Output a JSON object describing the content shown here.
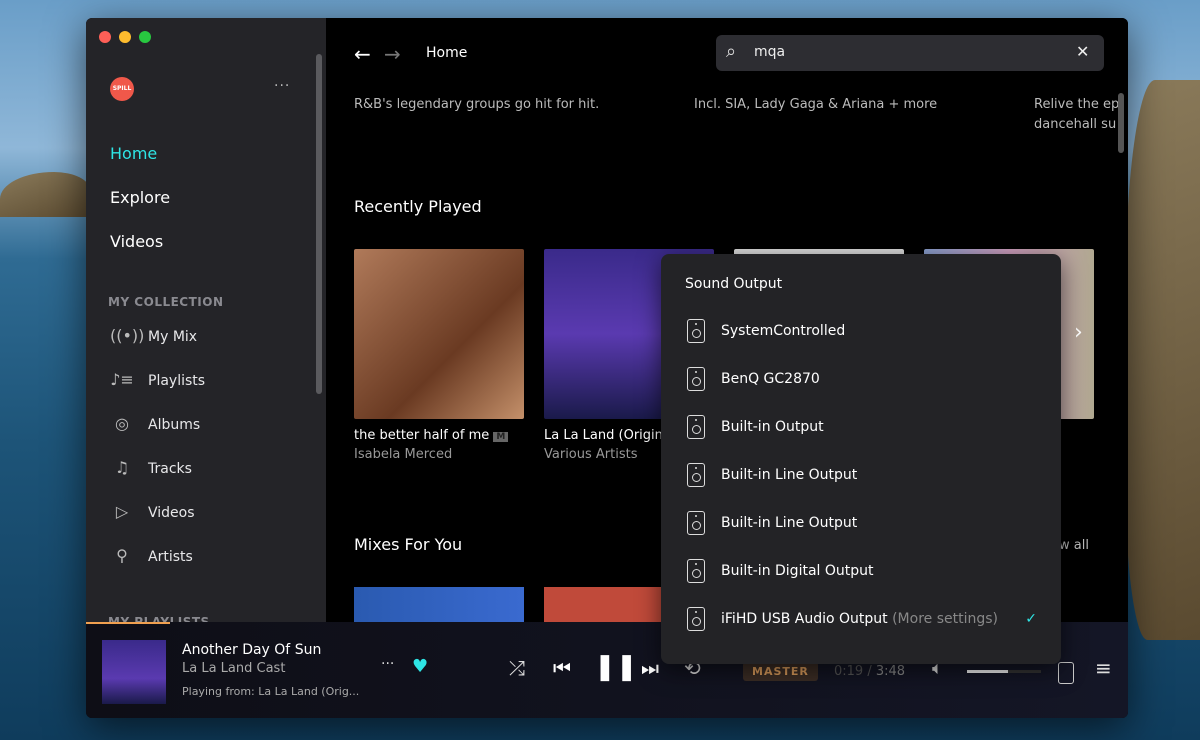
{
  "window": {
    "controls": [
      "close",
      "minimize",
      "maximize"
    ]
  },
  "sidebar": {
    "logo": "SPILL",
    "more": "···",
    "nav": [
      {
        "label": "Home",
        "active": true
      },
      {
        "label": "Explore"
      },
      {
        "label": "Videos"
      }
    ],
    "collection_header": "MY COLLECTION",
    "collection": [
      {
        "label": "My Mix",
        "icon": "radio-icon"
      },
      {
        "label": "Playlists",
        "icon": "playlist-icon"
      },
      {
        "label": "Albums",
        "icon": "album-icon"
      },
      {
        "label": "Tracks",
        "icon": "note-icon"
      },
      {
        "label": "Videos",
        "icon": "video-icon"
      },
      {
        "label": "Artists",
        "icon": "microphone-icon"
      }
    ],
    "playlists_header": "MY PLAYLISTS"
  },
  "header": {
    "breadcrumb": "Home",
    "search_value": "mqa"
  },
  "main": {
    "descriptions": [
      "R&B's legendary groups go hit for hit.",
      "Incl. SIA, Lady Gaga & Ariana + more",
      "Relive the ep",
      "dancehall su"
    ],
    "recently_played": {
      "title": "Recently Played",
      "items": [
        {
          "title": "the better half of me",
          "badge": "M",
          "artist": "Isabela Merced"
        },
        {
          "title": "La La Land (Origin",
          "artist": "Various Artists"
        }
      ]
    },
    "mixes": {
      "title": "Mixes For You",
      "view_all": "w all"
    }
  },
  "sound_output": {
    "title": "Sound Output",
    "options": [
      {
        "label": "SystemControlled"
      },
      {
        "label": "BenQ GC2870"
      },
      {
        "label": "Built-in Output"
      },
      {
        "label": "Built-in Line Output"
      },
      {
        "label": "Built-in Line Output"
      },
      {
        "label": "Built-in Digital Output"
      },
      {
        "label": "iFiHD USB Audio Output",
        "extra": "(More settings)",
        "selected": true
      }
    ],
    "check": "✓"
  },
  "player": {
    "title": "Another Day Of Sun",
    "artist": "La La Land Cast",
    "playing_from": "Playing from:  La La Land (Orig...",
    "quality": "MASTER",
    "elapsed": "0:19",
    "separator": " / ",
    "duration": "3:48",
    "volume": 0.55,
    "progress": 0.08,
    "liked": true
  },
  "colors": {
    "accent": "#2ee5e5",
    "master": "#d89a5a",
    "logo": "#f0584a"
  }
}
